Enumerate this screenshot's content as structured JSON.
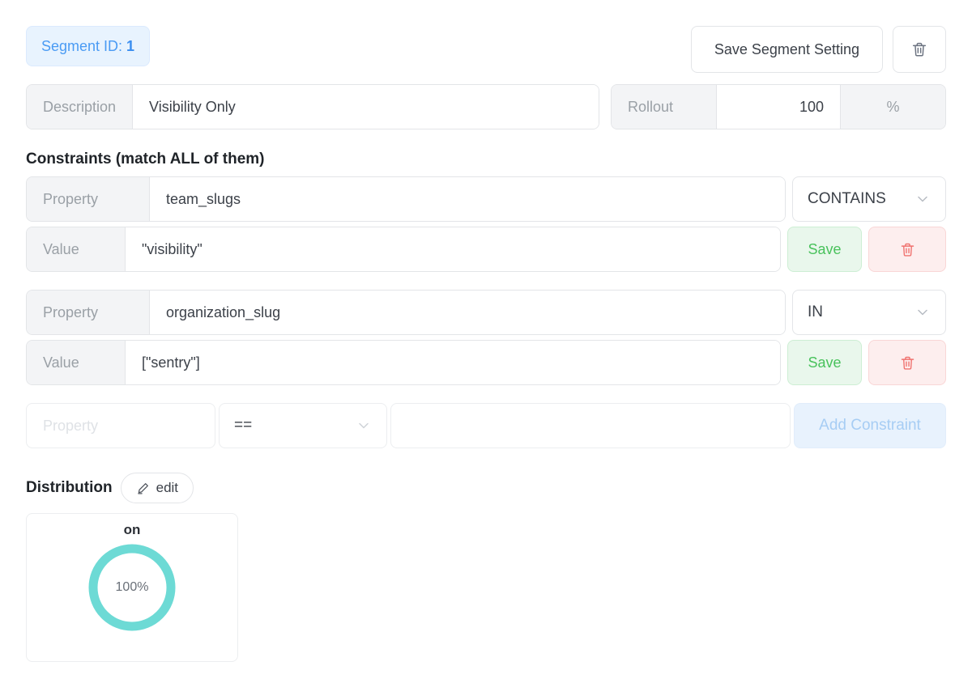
{
  "header": {
    "segment_label": "Segment ID:",
    "segment_value": "1",
    "save_segment_label": "Save Segment Setting",
    "delete_icon": "trash-icon"
  },
  "meta_row": {
    "description_label": "Description",
    "description_value": "Visibility Only",
    "rollout_label": "Rollout",
    "rollout_value": "100",
    "rollout_unit": "%"
  },
  "constraints": {
    "title": "Constraints (match ALL of them)",
    "property_label": "Property",
    "value_label": "Value",
    "save_label": "Save",
    "delete_icon": "trash-icon",
    "items": [
      {
        "property": "team_slugs",
        "operator": "CONTAINS",
        "value": "\"visibility\""
      },
      {
        "property": "organization_slug",
        "operator": "IN",
        "value": "[\"sentry\"]"
      }
    ],
    "new_row": {
      "property_placeholder": "Property",
      "property_value": "",
      "operator": "==",
      "value": "",
      "add_label": "Add Constraint"
    }
  },
  "distribution": {
    "title": "Distribution",
    "edit_label": "edit",
    "edit_icon": "pencil-icon",
    "chart_data": {
      "type": "pie",
      "title": "on",
      "categories": [
        "on"
      ],
      "values": [
        100
      ],
      "labels": [
        "100%"
      ],
      "center_label": "100%",
      "colors": [
        "#6ddad5"
      ],
      "donut": true
    }
  },
  "colors": {
    "accent_blue": "#4a9bf4",
    "badge_bg": "#e8f3fe",
    "save_green": "#49c25c",
    "save_green_bg": "#e9f7ec",
    "delete_red": "#f0726f",
    "delete_red_bg": "#fdeeee",
    "teal": "#6ddad5",
    "border": "#e3e5e8"
  }
}
